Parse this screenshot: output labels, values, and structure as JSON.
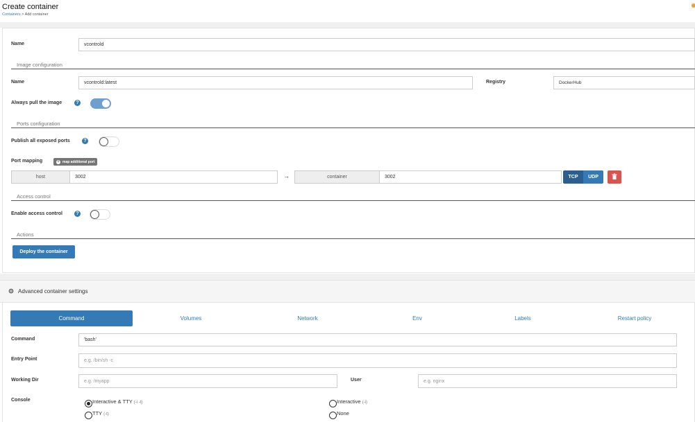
{
  "header": {
    "title": "Create container",
    "breadcrumb": {
      "link": "Containers",
      "separator": " > ",
      "current": "Add container"
    }
  },
  "form": {
    "name_label": "Name",
    "name_value": "vcontrold",
    "image_section": "Image configuration",
    "image_name_label": "Name",
    "image_name_value": "vcontrold:latest",
    "registry_label": "Registry",
    "registry_value": "DockerHub",
    "always_pull_label": "Always pull the image",
    "always_pull_on": true,
    "ports_section": "Ports configuration",
    "publish_all_label": "Publish all exposed ports",
    "publish_all_on": false,
    "port_mapping_label": "Port mapping",
    "map_port_button": "map additional port",
    "port_mappings": [
      {
        "host_addon": "host",
        "host_value": "3002",
        "container_addon": "container",
        "container_value": "3002",
        "tcp": "TCP",
        "udp": "UDP",
        "protocol": "TCP"
      }
    ],
    "access_section": "Access control",
    "enable_access_label": "Enable access control",
    "enable_access_on": false,
    "actions_section": "Actions",
    "deploy_button": "Deploy the container"
  },
  "advanced": {
    "title": "Advanced container settings",
    "tabs": [
      {
        "label": "Command",
        "active": true
      },
      {
        "label": "Volumes",
        "active": false
      },
      {
        "label": "Network",
        "active": false
      },
      {
        "label": "Env",
        "active": false
      },
      {
        "label": "Labels",
        "active": false
      },
      {
        "label": "Restart policy",
        "active": false
      }
    ],
    "command_label": "Command",
    "command_value": "'bash'",
    "entry_point_label": "Entry Point",
    "entry_point_placeholder": "e.g. /bin/sh -c",
    "working_dir_label": "Working Dir",
    "working_dir_placeholder": "e.g. /myapp",
    "user_label": "User",
    "user_placeholder": "e.g. nginx",
    "console_label": "Console",
    "console_options": [
      {
        "label": "Interactive & TTY",
        "hint": "(-i -t)",
        "checked": true
      },
      {
        "label": "Interactive",
        "hint": "(-i)",
        "checked": false
      },
      {
        "label": "TTY",
        "hint": "(-t)",
        "checked": false
      },
      {
        "label": "None",
        "hint": "",
        "checked": false
      }
    ]
  },
  "colors": {
    "primary": "#337ab7",
    "danger": "#d9534f",
    "toggle_on": "#6d9fd0"
  },
  "icons": {
    "help": "question-circle-icon",
    "plus": "plus-circle-icon",
    "arrow": "arrow-right-icon",
    "trash": "trash-icon",
    "gear": "gear-icon"
  }
}
